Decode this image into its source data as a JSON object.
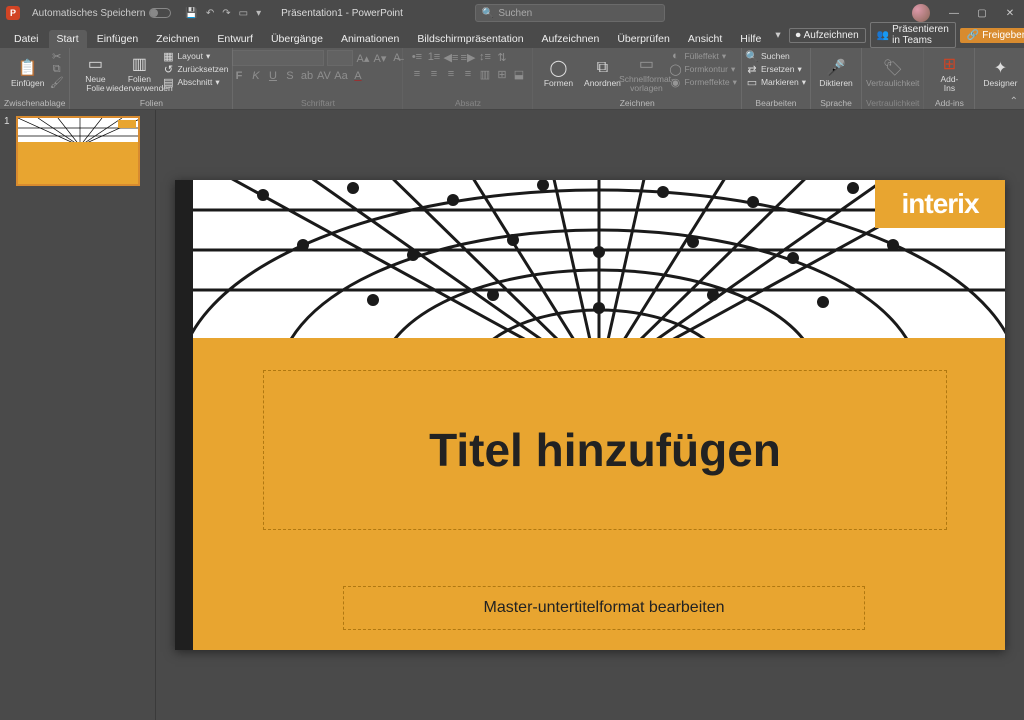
{
  "titlebar": {
    "autosave_label": "Automatisches Speichern",
    "doc_title": "Präsentation1 - PowerPoint",
    "search_placeholder": "Suchen"
  },
  "menu": {
    "tabs": [
      "Datei",
      "Start",
      "Einfügen",
      "Zeichnen",
      "Entwurf",
      "Übergänge",
      "Animationen",
      "Bildschirmpräsentation",
      "Aufzeichnen",
      "Überprüfen",
      "Ansicht",
      "Hilfe"
    ],
    "active_index": 1,
    "record": "Aufzeichnen",
    "teams": "Präsentieren in Teams",
    "share": "Freigeben"
  },
  "ribbon": {
    "clipboard": {
      "paste": "Einfügen",
      "label": "Zwischenablage"
    },
    "slides": {
      "new_slide": "Neue\nFolie",
      "reuse": "Folien\nwiederverwenden",
      "layout": "Layout",
      "reset": "Zurücksetzen",
      "section": "Abschnitt",
      "label": "Folien"
    },
    "font": {
      "label": "Schriftart"
    },
    "paragraph": {
      "label": "Absatz"
    },
    "drawing": {
      "shapes": "Formen",
      "arrange": "Anordnen",
      "quickstyles": "Schnellformat-\nvorlagen",
      "fill": "Fülleffekt",
      "outline": "Formkontur",
      "effects": "Formeffekte",
      "label": "Zeichnen"
    },
    "editing": {
      "find": "Suchen",
      "replace": "Ersetzen",
      "select": "Markieren",
      "label": "Bearbeiten"
    },
    "voice": {
      "dictate": "Diktieren",
      "label": "Sprache"
    },
    "sensitivity": {
      "btn": "Vertraulichkeit",
      "label": "Vertraulichkeit"
    },
    "addins": {
      "btn": "Add-\nIns",
      "label": "Add-ins"
    },
    "designer": {
      "btn": "Designer"
    }
  },
  "thumbs": {
    "num1": "1"
  },
  "slide": {
    "logo": "interix",
    "title": "Titel hinzufügen",
    "subtitle": "Master-untertitelformat bearbeiten"
  }
}
